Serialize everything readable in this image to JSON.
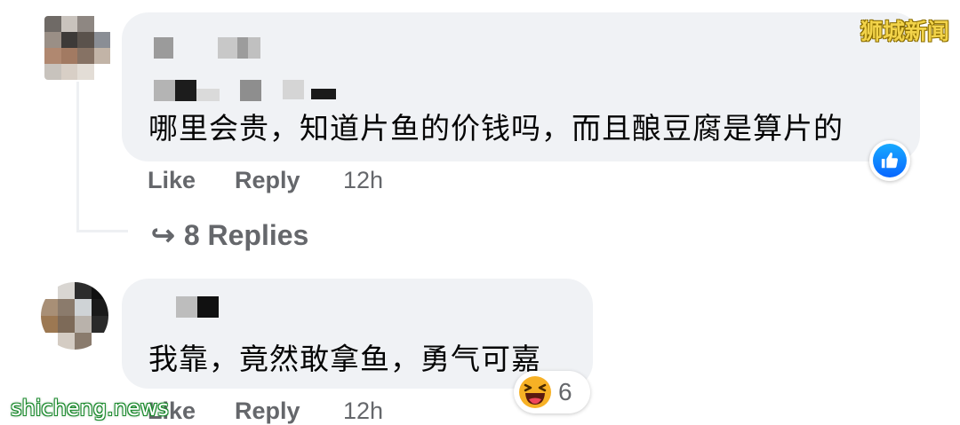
{
  "comments": [
    {
      "text": "哪里会贵，知道片鱼的价钱吗，而且酿豆腐是算片的",
      "actions": {
        "like": "Like",
        "reply": "Reply",
        "time": "12h"
      },
      "replies_link": "8 Replies",
      "reaction": "like-icon"
    },
    {
      "text": "我靠，竟然敢拿鱼，勇气可嘉",
      "actions": {
        "like": "Like",
        "reply": "Reply",
        "time": "12h"
      },
      "reaction_count": "6",
      "reaction": "laughing-emoji-icon"
    }
  ],
  "watermarks": {
    "top_right": "狮城新闻",
    "bottom_left": "shicheng.news"
  },
  "colors": {
    "bubble": "#f0f2f5",
    "action_text": "#65676b",
    "like_blue": "#0866ff"
  }
}
